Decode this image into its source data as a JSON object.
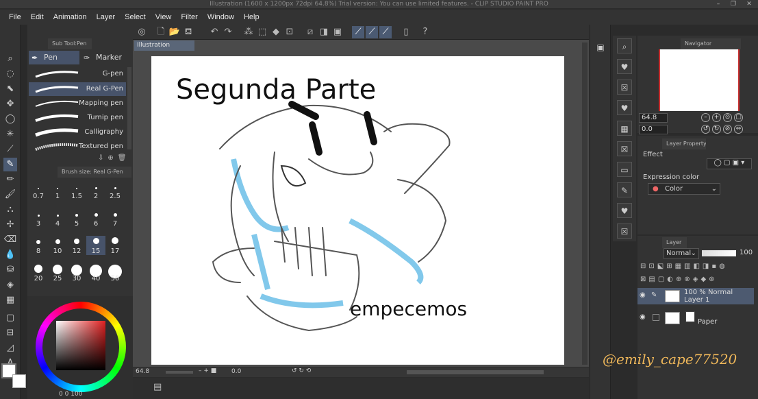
{
  "window": {
    "title": "Illustration (1600 x 1200px 72dpi 64.8%)  Trial version: You can use limited features. - CLIP STUDIO PAINT PRO",
    "controls": [
      "–",
      "❐",
      "✕"
    ]
  },
  "menu": [
    "File",
    "Edit",
    "Animation",
    "Layer",
    "Select",
    "View",
    "Filter",
    "Window",
    "Help"
  ],
  "sub_tool": {
    "header": "Sub Tool:Pen",
    "tabs": [
      "Pen",
      "Marker"
    ],
    "pens": [
      {
        "label": "G-pen",
        "selected": false
      },
      {
        "label": "Real G-Pen",
        "selected": true
      },
      {
        "label": "Mapping pen",
        "selected": false
      },
      {
        "label": "Turnip pen",
        "selected": false
      },
      {
        "label": "Calligraphy",
        "selected": false
      },
      {
        "label": "Textured pen",
        "selected": false
      }
    ]
  },
  "brush_size": {
    "header": "Brush size: Real G-Pen",
    "sizes": [
      "0.7",
      "1",
      "1.5",
      "2",
      "2.5",
      "3",
      "4",
      "5",
      "6",
      "7",
      "8",
      "10",
      "12",
      "15",
      "17",
      "20",
      "25",
      "30",
      "40",
      "50"
    ],
    "selected": "15"
  },
  "canvas": {
    "tab": "Illustration",
    "drawing_title": "Segunda Parte",
    "drawing_caption": "empecemos"
  },
  "status": {
    "zoom": "64.8",
    "angle": "0.0"
  },
  "color_values": {
    "a": "0",
    "b": "0",
    "v": "100"
  },
  "navigator": {
    "header": "Navigator",
    "zoom": "64.8",
    "rotation": "0.0"
  },
  "layer_property": {
    "header": "Layer Property",
    "effect": "Effect",
    "expression_color": "Expression color",
    "color_mode": "Color"
  },
  "layers": {
    "header": "Layer",
    "blend_mode": "Normal",
    "opacity": "100",
    "items": [
      {
        "line1": "100 % Normal",
        "line2": "Layer 1",
        "selected": true
      },
      {
        "line1": "",
        "line2": "Paper",
        "selected": false
      }
    ]
  },
  "watermark": "@emily_cape77520",
  "colors": {
    "accent": "#4b5a72",
    "sketch_blue": "#5fb8e8",
    "watermark": "#f0b85a"
  }
}
